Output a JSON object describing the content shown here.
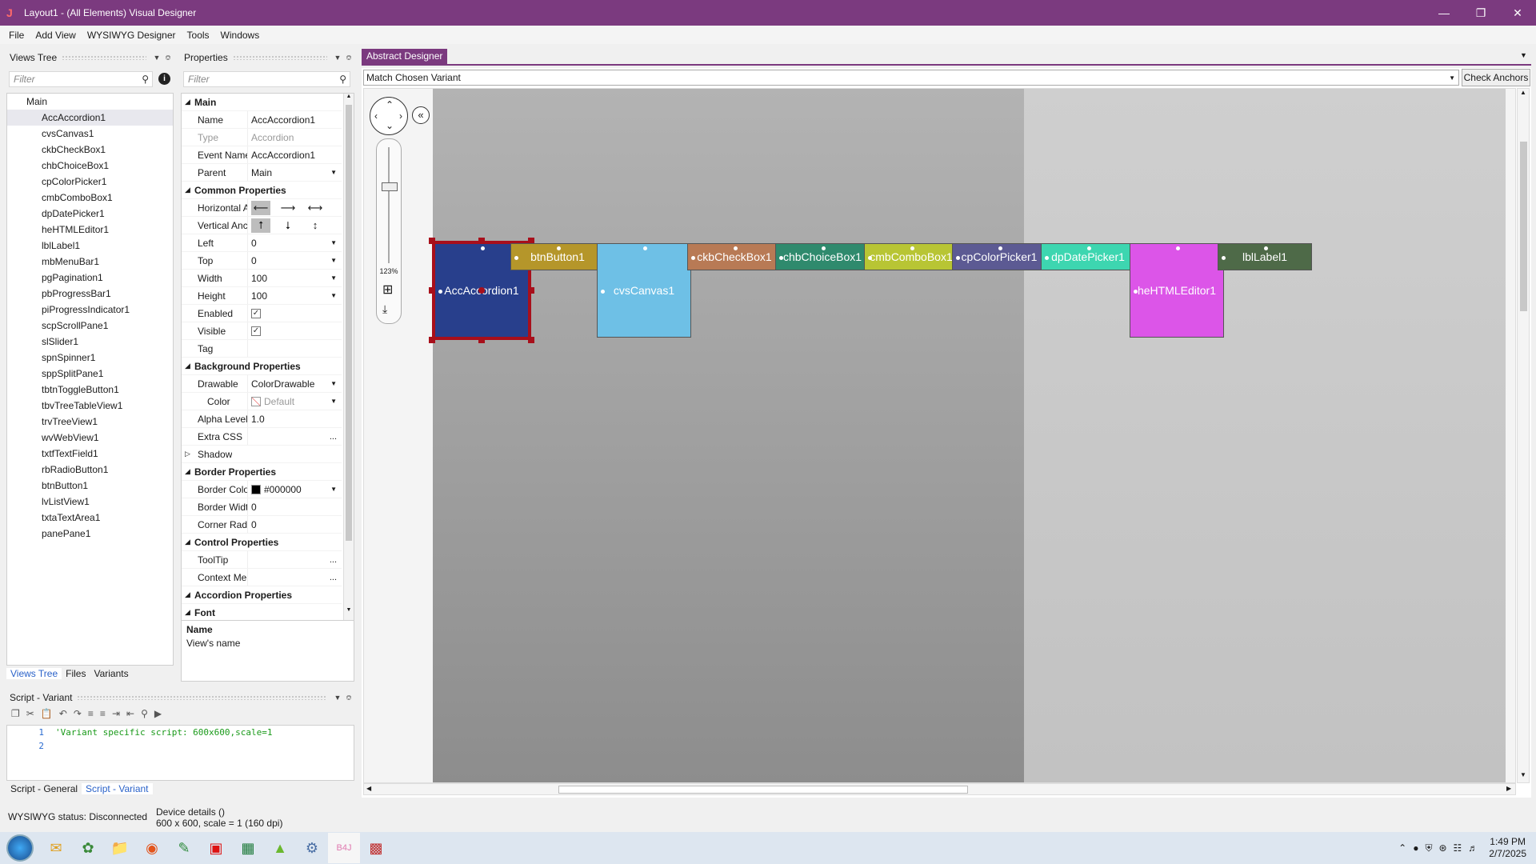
{
  "window": {
    "title": "Layout1 - (All Elements) Visual Designer",
    "app_icon": "J"
  },
  "menu": [
    "File",
    "Add View",
    "WYSIWYG Designer",
    "Tools",
    "Windows"
  ],
  "views_tree": {
    "header": "Views Tree",
    "filter_placeholder": "Filter",
    "root": "Main",
    "items": [
      "AccAccordion1",
      "cvsCanvas1",
      "ckbCheckBox1",
      "chbChoiceBox1",
      "cpColorPicker1",
      "cmbComboBox1",
      "dpDatePicker1",
      "heHTMLEditor1",
      "lblLabel1",
      "mbMenuBar1",
      "pgPagination1",
      "pbProgressBar1",
      "piProgressIndicator1",
      "scpScrollPane1",
      "slSlider1",
      "spnSpinner1",
      "sppSplitPane1",
      "tbtnToggleButton1",
      "tbvTreeTableView1",
      "trvTreeView1",
      "wvWebView1",
      "txtfTextField1",
      "rbRadioButton1",
      "btnButton1",
      "lvListView1",
      "txtaTextArea1",
      "panePane1"
    ],
    "tabs": [
      "Views Tree",
      "Files",
      "Variants"
    ]
  },
  "properties": {
    "header": "Properties",
    "filter_placeholder": "Filter",
    "rows": [
      {
        "type": "section",
        "label": "Main"
      },
      {
        "label": "Name",
        "value": "AccAccordion1"
      },
      {
        "label": "Type",
        "value": "Accordion",
        "disabled": true
      },
      {
        "label": "Event Name",
        "value": "AccAccordion1"
      },
      {
        "label": "Parent",
        "value": "Main",
        "dropdown": true
      },
      {
        "type": "section",
        "label": "Common Properties"
      },
      {
        "label": "Horizontal A...",
        "value": "",
        "anchors": [
          "⟵",
          "⟶",
          "⟷"
        ]
      },
      {
        "label": "Vertical Anc...",
        "value": "",
        "anchors": [
          "⭡",
          "⭣",
          "↕"
        ]
      },
      {
        "label": "Left",
        "value": "0",
        "dropdown": true
      },
      {
        "label": "Top",
        "value": "0",
        "dropdown": true
      },
      {
        "label": "Width",
        "value": "100",
        "dropdown": true
      },
      {
        "label": "Height",
        "value": "100",
        "dropdown": true
      },
      {
        "label": "Enabled",
        "value": "",
        "checkbox": true
      },
      {
        "label": "Visible",
        "value": "",
        "checkbox": true
      },
      {
        "label": "Tag",
        "value": ""
      },
      {
        "type": "section",
        "label": "Background Properties"
      },
      {
        "label": "Drawable",
        "value": "ColorDrawable",
        "dropdown": true
      },
      {
        "label": "Color",
        "value": "Default",
        "dropdown": true,
        "swatch": "none",
        "indent": true
      },
      {
        "label": "Alpha Level",
        "value": "1.0"
      },
      {
        "label": "Extra CSS",
        "value": "",
        "ellipsis": true
      },
      {
        "type": "collapsed",
        "label": "Shadow"
      },
      {
        "type": "section",
        "label": "Border Properties"
      },
      {
        "label": "Border Color",
        "value": "#000000",
        "dropdown": true,
        "swatch": "#000000"
      },
      {
        "label": "Border Width",
        "value": "0"
      },
      {
        "label": "Corner Radius",
        "value": "0"
      },
      {
        "type": "section",
        "label": "Control Properties"
      },
      {
        "label": "ToolTip",
        "value": "",
        "ellipsis": true
      },
      {
        "label": "Context Menu",
        "value": "",
        "ellipsis": true
      },
      {
        "type": "section",
        "label": "Accordion Properties"
      },
      {
        "type": "section",
        "label": "Font"
      }
    ],
    "desc_title": "Name",
    "desc_text": "View's name"
  },
  "script_panel": {
    "header": "Script - Variant",
    "lines": [
      {
        "n": "1",
        "text": "'Variant specific script: 600x600,scale=1"
      },
      {
        "n": "2",
        "text": ""
      }
    ],
    "tabs": [
      "Script - General",
      "Script - Variant"
    ]
  },
  "designer": {
    "tab": "Abstract Designer",
    "variant_select": "Match Chosen Variant",
    "check_anchors": "Check Anchors",
    "zoom": "123%",
    "views": [
      {
        "label": "AccAccordion1",
        "color": "#283f8c"
      },
      {
        "label": "btnButton1",
        "color": "#b5962a"
      },
      {
        "label": "cvsCanvas1",
        "color": "#6ec0e6"
      },
      {
        "label": "ckbCheckBox1",
        "color": "#b87a55"
      },
      {
        "label": "chbChoiceBox1",
        "color": "#2f8a6d"
      },
      {
        "label": "cmbComboBox1",
        "color": "#b8c534"
      },
      {
        "label": "cpColorPicker1",
        "color": "#5c5a93"
      },
      {
        "label": "dpDatePicker1",
        "color": "#3dd6b0"
      },
      {
        "label": "heHTMLEditor1",
        "color": "#dc55e8"
      },
      {
        "label": "lblLabel1",
        "color": "#4e6a48"
      }
    ]
  },
  "status": {
    "wysiwyg": "WYSIWYG status: Disconnected",
    "device_title": "Device details ()",
    "device_detail": "600 x 600, scale = 1 (160 dpi)"
  },
  "taskbar": {
    "icons": [
      "start-orb",
      "mail-icon",
      "settings-app",
      "folder-icon",
      "firefox-icon",
      "notepad-icon",
      "acrobat-icon",
      "excel-icon",
      "android-icon",
      "gear-app",
      "b4j-icon",
      "rubik-icon"
    ],
    "time": "1:49 PM",
    "date": "2/7/2025"
  }
}
